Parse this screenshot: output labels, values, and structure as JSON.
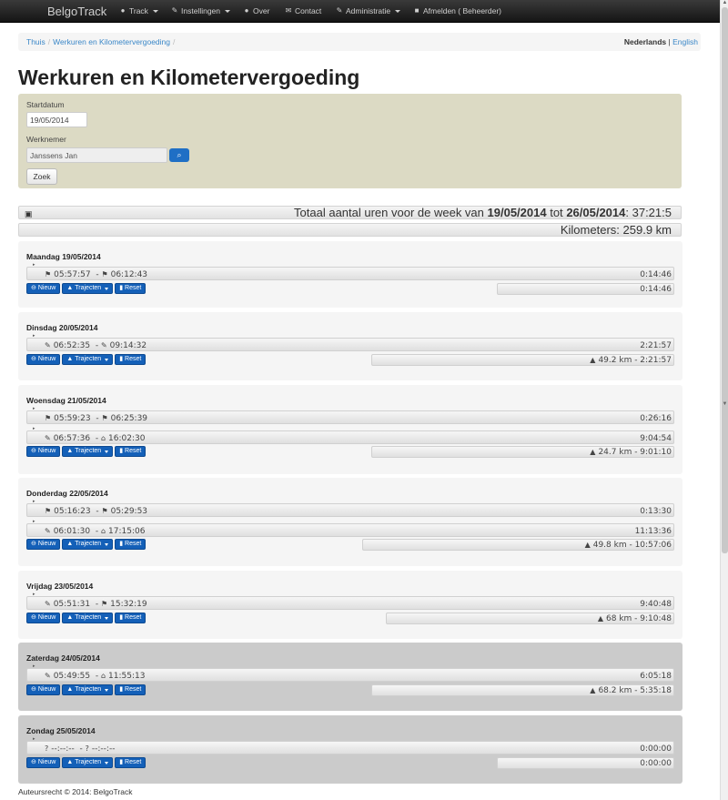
{
  "navbar": {
    "brand": "BelgoTrack",
    "items": [
      {
        "icon": "globe-icon",
        "glyph": "●",
        "label": "Track",
        "dropdown": true
      },
      {
        "icon": "wrench-icon",
        "glyph": "✎",
        "label": "Instellingen",
        "dropdown": true
      },
      {
        "icon": "info-icon",
        "glyph": "●",
        "label": "Over",
        "dropdown": false
      },
      {
        "icon": "envelope-icon",
        "glyph": "✉",
        "label": "Contact",
        "dropdown": false
      },
      {
        "icon": "wrench-icon",
        "glyph": "✎",
        "label": "Administratie",
        "dropdown": true
      },
      {
        "icon": "lock-icon",
        "glyph": "■",
        "label": "Afmelden ( Beheerder)",
        "dropdown": false
      }
    ]
  },
  "breadcrumb": {
    "home": "Thuis",
    "current": "Werkuren en Kilometervergoeding",
    "sep": "/"
  },
  "language": {
    "active": "Nederlands",
    "sep": "|",
    "other": "English"
  },
  "page_title": "Werkuren en Kilometervergoeding",
  "filter": {
    "start_label": "Startdatum",
    "start_value": "19/05/2014",
    "employee_label": "Werknemer",
    "employee_value": "Janssens Jan",
    "search_button": "Zoek"
  },
  "totals": {
    "hours_prefix": "Totaal aantal uren voor de week van",
    "week_start": "19/05/2014",
    "to": "tot",
    "week_end": "26/05/2014",
    "hours": ": 37:21:5",
    "km_label": "Kilometers:",
    "km_value": "259.9 km"
  },
  "buttons": {
    "new": "Nieuw",
    "trips": "Trajecten",
    "reset": "Reset"
  },
  "days": [
    {
      "title": "Maandag 19/05/2014",
      "weekend": false,
      "trips": [
        {
          "start_icon": "flag-icon",
          "start": "05:57:57",
          "end_icon": "flag-icon",
          "end": "06:12:43",
          "duration": "0:14:46"
        }
      ],
      "summary": "0:14:46",
      "summary_has_road": false
    },
    {
      "title": "Dinsdag 20/05/2014",
      "weekend": false,
      "trips": [
        {
          "start_icon": "wrench-icon",
          "start": "06:52:35",
          "end_icon": "wrench-icon",
          "end": "09:14:32",
          "duration": "2:21:57"
        }
      ],
      "summary": "49.2 km - 2:21:57",
      "summary_has_road": true
    },
    {
      "title": "Woensdag 21/05/2014",
      "weekend": false,
      "trips": [
        {
          "start_icon": "flag-icon",
          "start": "05:59:23",
          "end_icon": "flag-icon",
          "end": "06:25:39",
          "duration": "0:26:16"
        },
        {
          "start_icon": "wrench-icon",
          "start": "06:57:36",
          "end_icon": "home-icon",
          "end": "16:02:30",
          "duration": "9:04:54"
        }
      ],
      "summary": "24.7 km - 9:01:10",
      "summary_has_road": true
    },
    {
      "title": "Donderdag 22/05/2014",
      "weekend": false,
      "trips": [
        {
          "start_icon": "flag-icon",
          "start": "05:16:23",
          "end_icon": "flag-icon",
          "end": "05:29:53",
          "duration": "0:13:30"
        },
        {
          "start_icon": "wrench-icon",
          "start": "06:01:30",
          "end_icon": "home-icon",
          "end": "17:15:06",
          "duration": "11:13:36"
        }
      ],
      "summary": "49.8 km - 10:57:06",
      "summary_has_road": true
    },
    {
      "title": "Vrijdag 23/05/2014",
      "weekend": false,
      "trips": [
        {
          "start_icon": "wrench-icon",
          "start": "05:51:31",
          "end_icon": "flag-icon",
          "end": "15:32:19",
          "duration": "9:40:48"
        }
      ],
      "summary": "68 km - 9:10:48",
      "summary_has_road": true
    },
    {
      "title": "Zaterdag 24/05/2014",
      "weekend": true,
      "trips": [
        {
          "start_icon": "wrench-icon",
          "start": "05:49:55",
          "end_icon": "home-icon",
          "end": "11:55:13",
          "duration": "6:05:18"
        }
      ],
      "summary": "68.2 km - 5:35:18",
      "summary_has_road": true
    },
    {
      "title": "Zondag 25/05/2014",
      "weekend": true,
      "trips": [
        {
          "start_icon": "question-icon",
          "start": "--:--:--",
          "end_icon": "question-icon",
          "end": "--:--:--",
          "duration": "0:00:00"
        }
      ],
      "summary": "0:00:00",
      "summary_has_road": false
    }
  ],
  "footer": "Auteursrecht © 2014: BelgoTrack"
}
